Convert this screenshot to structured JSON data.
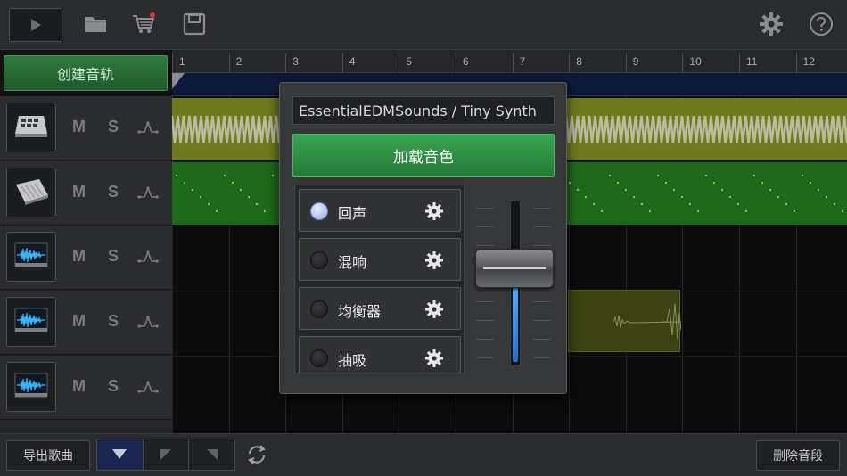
{
  "toolbar": {
    "play": "play-icon",
    "open": "folder-icon",
    "store": "cart-icon",
    "save": "save-icon",
    "settings": "gear-icon",
    "help": "help-icon"
  },
  "sidebar": {
    "create_track_label": "创建音轨",
    "tracks": [
      {
        "icon": "drum-pad-icon",
        "mute": "M",
        "solo": "S"
      },
      {
        "icon": "synth-keyboard-icon",
        "mute": "M",
        "solo": "S"
      },
      {
        "icon": "waveform-icon",
        "mute": "M",
        "solo": "S"
      },
      {
        "icon": "waveform-icon",
        "mute": "M",
        "solo": "S"
      },
      {
        "icon": "waveform-icon",
        "mute": "M",
        "solo": "S"
      }
    ]
  },
  "timeline": {
    "bars": [
      "1",
      "2",
      "3",
      "4",
      "5",
      "6",
      "7",
      "8",
      "9",
      "10",
      "11",
      "12"
    ]
  },
  "dialog": {
    "preset_name": "EssentialEDMSounds / Tiny Synth",
    "load_label": "加载音色",
    "effects": [
      {
        "label": "回声",
        "on": true
      },
      {
        "label": "混响",
        "on": false
      },
      {
        "label": "均衡器",
        "on": false
      },
      {
        "label": "抽吸",
        "on": false
      }
    ],
    "volume_level": 0.58
  },
  "bottom": {
    "export_label": "导出歌曲",
    "delete_label": "删除音段"
  },
  "colors": {
    "accent_green": "#2f8f45",
    "synth_clip": "#6f7a1c",
    "keys_clip": "#1f6a1a",
    "volume_blue": "#2f8fff"
  }
}
